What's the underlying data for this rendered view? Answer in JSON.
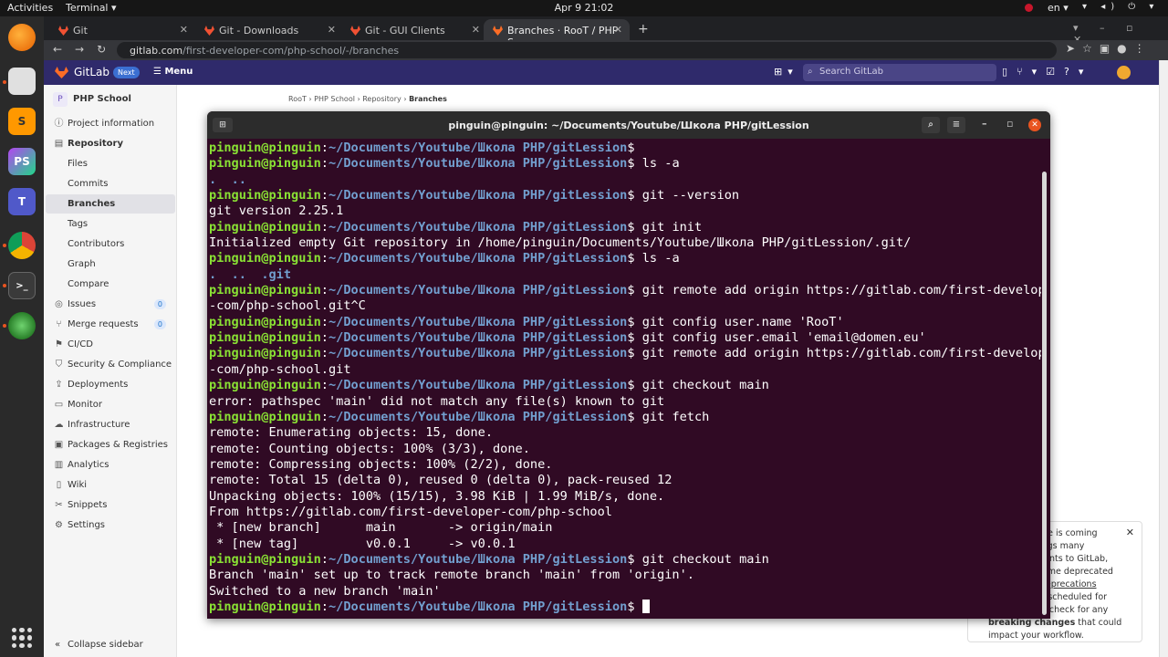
{
  "topbar": {
    "activities": "Activities",
    "app": "Terminal ▾",
    "clock": "Apr 9  21:02",
    "lang": "en ▾",
    "sys_icons": "▾ ◂) ⏻ ▾"
  },
  "browser": {
    "tabs": [
      {
        "label": "Git"
      },
      {
        "label": "Git - Downloads"
      },
      {
        "label": "Git - GUI Clients"
      },
      {
        "label": "Branches · RooT / PHP Sc"
      }
    ],
    "url_host": "gitlab.com",
    "url_path": "/first-developer-com/php-school/-/branches"
  },
  "gitlab": {
    "brand": "GitLab",
    "next_badge": "Next",
    "menu": "Menu",
    "search_placeholder": "Search GitLab",
    "project_initial": "P",
    "project_name": "PHP School",
    "nav": {
      "project_information": "Project information",
      "repository": "Repository",
      "files": "Files",
      "commits": "Commits",
      "branches": "Branches",
      "tags": "Tags",
      "contributors": "Contributors",
      "graph": "Graph",
      "compare": "Compare",
      "issues": "Issues",
      "issues_count": "0",
      "merge_requests": "Merge requests",
      "merge_requests_count": "0",
      "cicd": "CI/CD",
      "security": "Security & Compliance",
      "deployments": "Deployments",
      "monitor": "Monitor",
      "infrastructure": "Infrastructure",
      "packages": "Packages & Registries",
      "analytics": "Analytics",
      "wiki": "Wiki",
      "snippets": "Snippets",
      "settings": "Settings",
      "collapse": "Collapse sidebar"
    },
    "breadcrumb": {
      "c1": "RooT",
      "c2": "PHP School",
      "c3": "Repository",
      "c4": "Branches"
    },
    "notice": {
      "l1": "elease is coming",
      "l2": "brings many",
      "l3": "ements to GitLab,",
      "l4": "s some deprecated",
      "l5a": "e ",
      "l5b": "deprecations",
      "l6": "t is scheduled for",
      "l7": "and check for any",
      "l8a": "breaking changes",
      "l8b": " that could",
      "l9": "impact your workflow."
    }
  },
  "terminal": {
    "title": "pinguin@pinguin: ~/Documents/Youtube/Школа PHP/gitLession",
    "user": "pinguin@pinguin",
    "path": "~/Documents/Youtube/Школа PHP/gitLession",
    "lines": {
      "c1": "",
      "c2": "ls -a",
      "o2a": ".",
      "o2b": "..",
      "c3": "git --version",
      "o3": "git version 2.25.1",
      "c4": "git init",
      "o4": "Initialized empty Git repository in /home/pinguin/Documents/Youtube/Школа PHP/gitLession/.git/",
      "c5": "ls -a",
      "o5a": ".",
      "o5b": "..",
      "o5c": ".git",
      "c6": "git remote add origin https://gitlab.com/first-developer",
      "o6": "-com/php-school.git^C",
      "c7": "git config user.name 'RooT'",
      "c8": "git config user.email 'email@domen.eu'",
      "c9": "git remote add origin https://gitlab.com/first-developer",
      "o9": "-com/php-school.git",
      "c10": "git checkout main",
      "o10": "error: pathspec 'main' did not match any file(s) known to git",
      "c11": "git fetch",
      "o11a": "remote: Enumerating objects: 15, done.",
      "o11b": "remote: Counting objects: 100% (3/3), done.",
      "o11c": "remote: Compressing objects: 100% (2/2), done.",
      "o11d": "remote: Total 15 (delta 0), reused 0 (delta 0), pack-reused 12",
      "o11e": "Unpacking objects: 100% (15/15), 3.98 KiB | 1.99 MiB/s, done.",
      "o11f": "From https://gitlab.com/first-developer-com/php-school",
      "o11g": " * [new branch]      main       -> origin/main",
      "o11h": " * [new tag]         v0.0.1     -> v0.0.1",
      "c12": "git checkout main",
      "o12a": "Branch 'main' set up to track remote branch 'main' from 'origin'.",
      "o12b": "Switched to a new branch 'main'",
      "c13": ""
    }
  },
  "colors": {
    "gitlab_header": "#2f2a6b",
    "terminal_bg": "#300a24",
    "prompt_user": "#8ae234",
    "prompt_path": "#729fcf"
  }
}
